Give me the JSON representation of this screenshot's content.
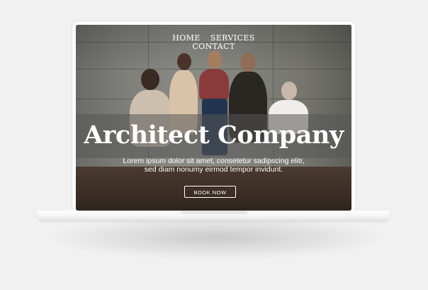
{
  "nav": {
    "items": [
      {
        "label": "HOME"
      },
      {
        "label": "SERVICES"
      },
      {
        "label": "CONTACT"
      }
    ]
  },
  "hero": {
    "title": "Architect Company",
    "subtitle_line1": "Lorem ipsum dolor sit amet, consetetur sadipscing elitr,",
    "subtitle_line2": "sed diam nonumy eirmod tempor invidunt.",
    "cta_label": "BOOK NOW"
  },
  "colors": {
    "page_background": "#f1f1f1",
    "hero_text": "#ffffff",
    "overlay_band": "rgba(85,85,85,0.55)"
  }
}
